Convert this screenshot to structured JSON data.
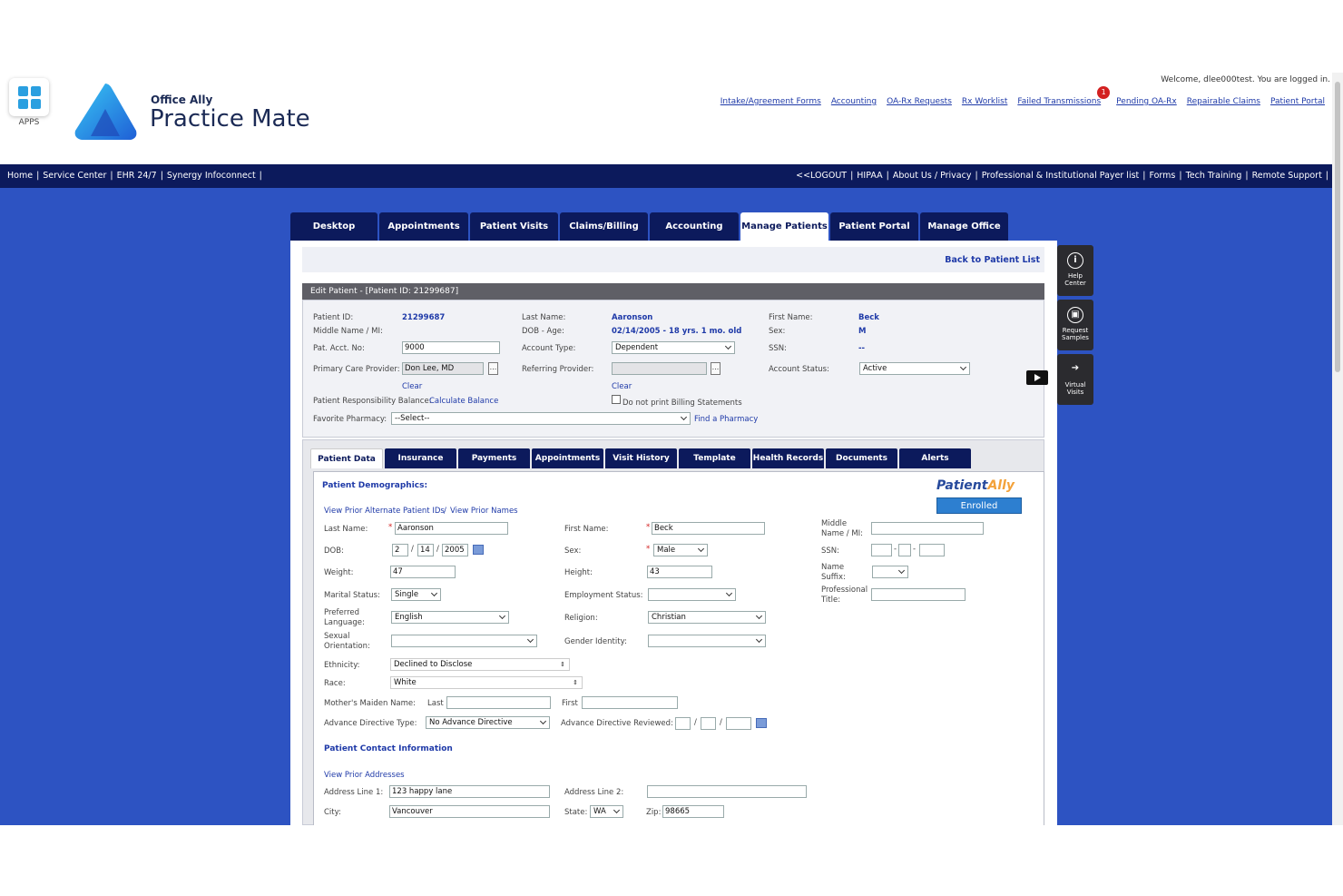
{
  "header": {
    "apps_label": "APPS",
    "logo_small": "Office Ally",
    "logo_big": "Practice Mate",
    "welcome": "Welcome, dlee000test. You are logged in.",
    "links": [
      "Intake/Agreement Forms",
      "Accounting",
      "OA-Rx Requests",
      "Rx Worklist",
      "Failed Transmissions",
      "Pending OA-Rx",
      "Repairable Claims",
      "Patient Portal"
    ],
    "notification_count": "1"
  },
  "navbar": {
    "left": [
      "Home",
      "Service Center",
      "EHR 24/7",
      "Synergy Infoconnect"
    ],
    "right": [
      "<<LOGOUT",
      "HIPAA",
      "About Us / Privacy",
      "Professional & Institutional Payer list",
      "Forms",
      "Tech Training",
      "Remote Support"
    ]
  },
  "main_tabs": [
    "Desktop",
    "Appointments",
    "Patient Visits",
    "Claims/Billing",
    "Accounting",
    "Manage Patients",
    "Patient Portal",
    "Manage Office"
  ],
  "active_main_tab": "Manage Patients",
  "back_link": "Back to Patient List",
  "edit_title": "Edit Patient - [Patient ID: 21299687]",
  "summary": {
    "patient_id_label": "Patient ID:",
    "patient_id": "21299687",
    "middle_label": "Middle Name / MI:",
    "last_name_label": "Last Name:",
    "last_name": "Aaronson",
    "dob_label": "DOB - Age:",
    "dob_age": "02/14/2005 - 18 yrs. 1 mo. old",
    "first_name_label": "First Name:",
    "first_name": "Beck",
    "sex_label": "Sex:",
    "sex": "M",
    "acct_label": "Pat. Acct. No:",
    "acct": "9000",
    "account_type_label": "Account Type:",
    "account_type": "Dependent",
    "ssn_label": "SSN:",
    "ssn": "--",
    "pcp_label": "Primary Care Provider:",
    "pcp": "Don Lee, MD",
    "referring_label": "Referring Provider:",
    "status_label": "Account Status:",
    "status": "Active",
    "clear": "Clear",
    "balance_label": "Patient Responsibility Balance:",
    "calc_balance": "Calculate Balance",
    "no_print": "Do not print Billing Statements",
    "pharmacy_label": "Favorite Pharmacy:",
    "pharmacy": "--Select--",
    "find_pharmacy": "Find a Pharmacy"
  },
  "sub_tabs": [
    "Patient Data",
    "Insurance",
    "Payments",
    "Appointments",
    "Visit History",
    "Template",
    "Health Records",
    "Documents",
    "Alerts"
  ],
  "active_sub_tab": "Patient Data",
  "demographics": {
    "title": "Patient Demographics:",
    "prior_ids": "View Prior Alternate Patient IDs",
    "prior_names": "View Prior Names",
    "portal_logo_1": "Patient",
    "portal_logo_2": "Ally",
    "enrolled": "Enrolled",
    "last_name_label": "Last Name:",
    "last_name": "Aaronson",
    "first_name_label": "First Name:",
    "first_name": "Beck",
    "middle_label_1": "Middle",
    "middle_label_2": "Name / MI:",
    "dob_label": "DOB:",
    "dob_m": "2",
    "dob_d": "14",
    "dob_y": "2005",
    "sex_label": "Sex:",
    "sex": "Male",
    "ssn_label": "SSN:",
    "weight_label": "Weight:",
    "weight": "47",
    "height_label": "Height:",
    "height": "43",
    "suffix_label_1": "Name",
    "suffix_label_2": "Suffix:",
    "marital_label": "Marital Status:",
    "marital": "Single",
    "employment_label": "Employment Status:",
    "prof_label_1": "Professional",
    "prof_label_2": "Title:",
    "lang_label_1": "Preferred",
    "lang_label_2": "Language:",
    "language": "English",
    "religion_label": "Religion:",
    "religion": "Christian",
    "sexual_label_1": "Sexual",
    "sexual_label_2": "Orientation:",
    "gender_label": "Gender Identity:",
    "ethnicity_label": "Ethnicity:",
    "ethnicity": "Declined to Disclose",
    "race_label": "Race:",
    "race": "White",
    "maiden_label": "Mother's Maiden Name:",
    "maiden_last": "Last",
    "maiden_first": "First",
    "adv_type_label": "Advance Directive Type:",
    "adv_type": "No Advance Directive",
    "adv_reviewed_label": "Advance Directive Reviewed:"
  },
  "contact": {
    "title": "Patient Contact Information",
    "prior_addresses": "View Prior Addresses",
    "addr1_label": "Address Line 1:",
    "addr1": "123 happy lane",
    "addr2_label": "Address Line 2:",
    "city_label": "City:",
    "city": "Vancouver",
    "state_label": "State:",
    "state": "WA",
    "zip_label": "Zip:",
    "zip": "98665"
  },
  "side_tools": [
    {
      "icon": "i",
      "l1": "Help",
      "l2": "Center"
    },
    {
      "icon": "▣",
      "l1": "Request",
      "l2": "Samples"
    },
    {
      "icon": "➔",
      "l1": "Virtual",
      "l2": "Visits"
    }
  ]
}
